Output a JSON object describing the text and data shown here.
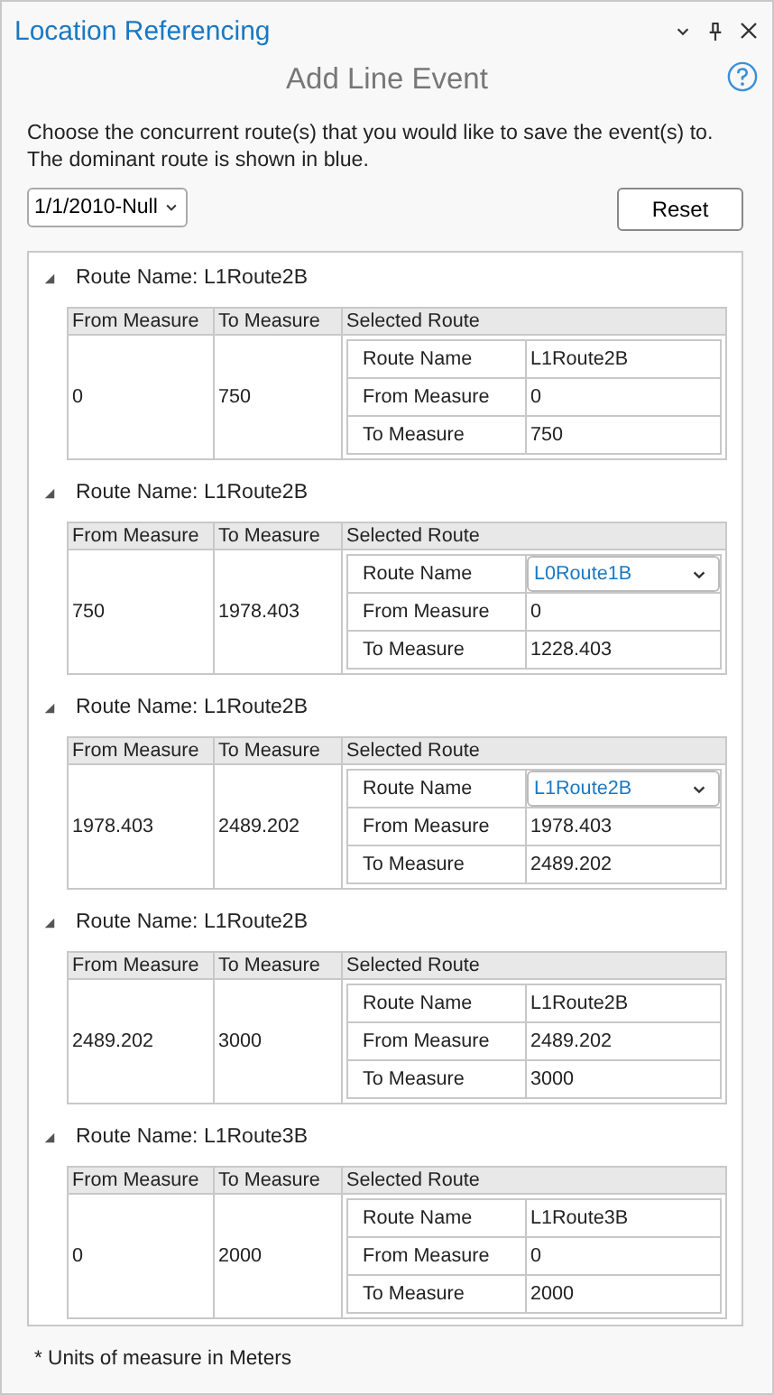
{
  "pane": {
    "title": "Location Referencing"
  },
  "heading": "Add Line Event",
  "instructions": "Choose the concurrent route(s) that you would like to save the event(s) to. The dominant route is shown in blue.",
  "date_dropdown": {
    "value": "1/1/2010-Null"
  },
  "reset_button": "Reset",
  "groups": [
    {
      "header": "Route Name: L1Route2B",
      "expanded": true,
      "columns": [
        "From Measure",
        "To Measure",
        "Selected Route"
      ],
      "from_measure": "0",
      "to_measure": "750",
      "selected_route": [
        {
          "label": "Route Name",
          "value": "L1Route2B",
          "kind": "text",
          "dominant": false
        },
        {
          "label": "From Measure",
          "value": "0",
          "kind": "text",
          "dominant": false
        },
        {
          "label": "To Measure",
          "value": "750",
          "kind": "text",
          "dominant": false
        }
      ]
    },
    {
      "header": "Route Name: L1Route2B",
      "expanded": true,
      "columns": [
        "From Measure",
        "To Measure",
        "Selected Route"
      ],
      "from_measure": "750",
      "to_measure": "1978.403",
      "selected_route": [
        {
          "label": "Route Name",
          "value": "L0Route1B",
          "kind": "dropdown",
          "dominant": true
        },
        {
          "label": "From Measure",
          "value": "0",
          "kind": "text",
          "dominant": false
        },
        {
          "label": "To Measure",
          "value": "1228.403",
          "kind": "text",
          "dominant": false
        }
      ]
    },
    {
      "header": "Route Name: L1Route2B",
      "expanded": true,
      "columns": [
        "From Measure",
        "To Measure",
        "Selected Route"
      ],
      "from_measure": "1978.403",
      "to_measure": "2489.202",
      "selected_route": [
        {
          "label": "Route Name",
          "value": "L1Route2B",
          "kind": "dropdown",
          "dominant": true
        },
        {
          "label": "From Measure",
          "value": "1978.403",
          "kind": "text",
          "dominant": false
        },
        {
          "label": "To Measure",
          "value": "2489.202",
          "kind": "text",
          "dominant": false
        }
      ]
    },
    {
      "header": "Route Name: L1Route2B",
      "expanded": true,
      "columns": [
        "From Measure",
        "To Measure",
        "Selected Route"
      ],
      "from_measure": "2489.202",
      "to_measure": "3000",
      "selected_route": [
        {
          "label": "Route Name",
          "value": "L1Route2B",
          "kind": "text",
          "dominant": false
        },
        {
          "label": "From Measure",
          "value": "2489.202",
          "kind": "text",
          "dominant": false
        },
        {
          "label": "To Measure",
          "value": "3000",
          "kind": "text",
          "dominant": false
        }
      ]
    },
    {
      "header": "Route Name: L1Route3B",
      "expanded": true,
      "columns": [
        "From Measure",
        "To Measure",
        "Selected Route"
      ],
      "from_measure": "0",
      "to_measure": "2000",
      "selected_route": [
        {
          "label": "Route Name",
          "value": "L1Route3B",
          "kind": "text",
          "dominant": false
        },
        {
          "label": "From Measure",
          "value": "0",
          "kind": "text",
          "dominant": false
        },
        {
          "label": "To Measure",
          "value": "2000",
          "kind": "text",
          "dominant": false
        }
      ]
    }
  ],
  "footnote": "* Units of measure in Meters"
}
